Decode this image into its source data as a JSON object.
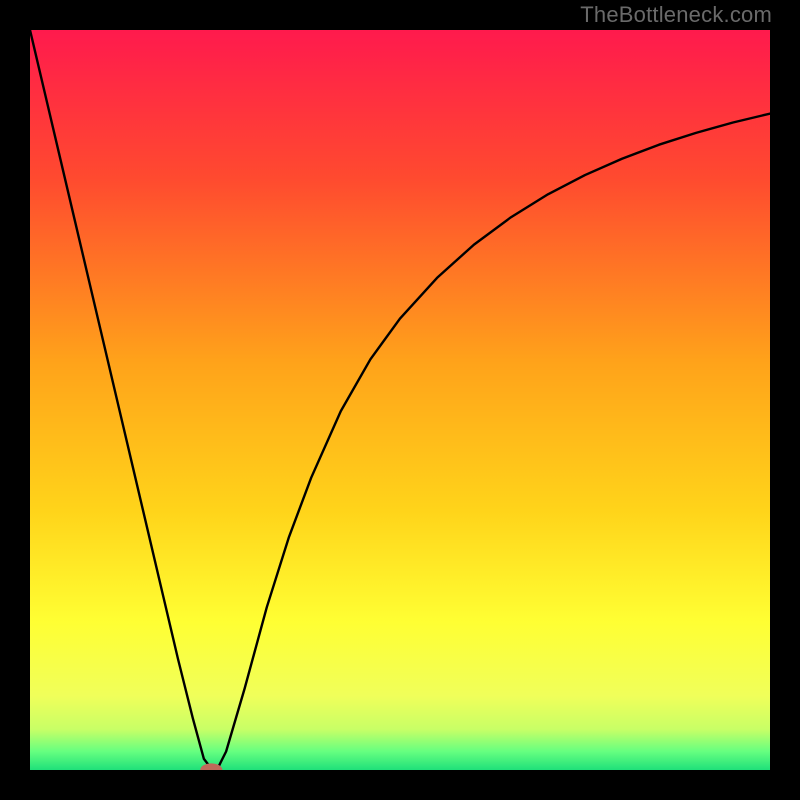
{
  "watermark": "TheBottleneck.com",
  "chart_data": {
    "type": "line",
    "title": "",
    "xlabel": "",
    "ylabel": "",
    "xlim": [
      0,
      100
    ],
    "ylim": [
      0,
      100
    ],
    "grid": false,
    "legend": false,
    "gradient_stops": [
      {
        "offset": 0.0,
        "color": "#ff1a4d"
      },
      {
        "offset": 0.2,
        "color": "#ff4a2f"
      },
      {
        "offset": 0.45,
        "color": "#ffa31a"
      },
      {
        "offset": 0.65,
        "color": "#ffd41a"
      },
      {
        "offset": 0.8,
        "color": "#ffff33"
      },
      {
        "offset": 0.9,
        "color": "#f0ff5a"
      },
      {
        "offset": 0.945,
        "color": "#c8ff66"
      },
      {
        "offset": 0.975,
        "color": "#66ff80"
      },
      {
        "offset": 1.0,
        "color": "#1fe07a"
      }
    ],
    "series": [
      {
        "name": "curve",
        "color": "#000000",
        "width": 2.4,
        "x": [
          0,
          2,
          4,
          6,
          8,
          10,
          12,
          14,
          16,
          18,
          20,
          22,
          23.5,
          24.5,
          25.5,
          26.5,
          29,
          32,
          35,
          38,
          42,
          46,
          50,
          55,
          60,
          65,
          70,
          75,
          80,
          85,
          90,
          95,
          100
        ],
        "values": [
          100,
          91.5,
          83,
          74.5,
          66,
          57.5,
          49,
          40.5,
          32,
          23.5,
          15,
          7,
          1.5,
          0.2,
          0.5,
          2.5,
          11,
          22,
          31.5,
          39.5,
          48.5,
          55.5,
          61,
          66.5,
          71,
          74.7,
          77.8,
          80.4,
          82.6,
          84.5,
          86.1,
          87.5,
          88.7
        ]
      }
    ],
    "marker": {
      "name": "min-point",
      "x": 24.5,
      "y": 0,
      "rx": 1.5,
      "ry": 0.9,
      "color": "#c06a5a"
    }
  }
}
